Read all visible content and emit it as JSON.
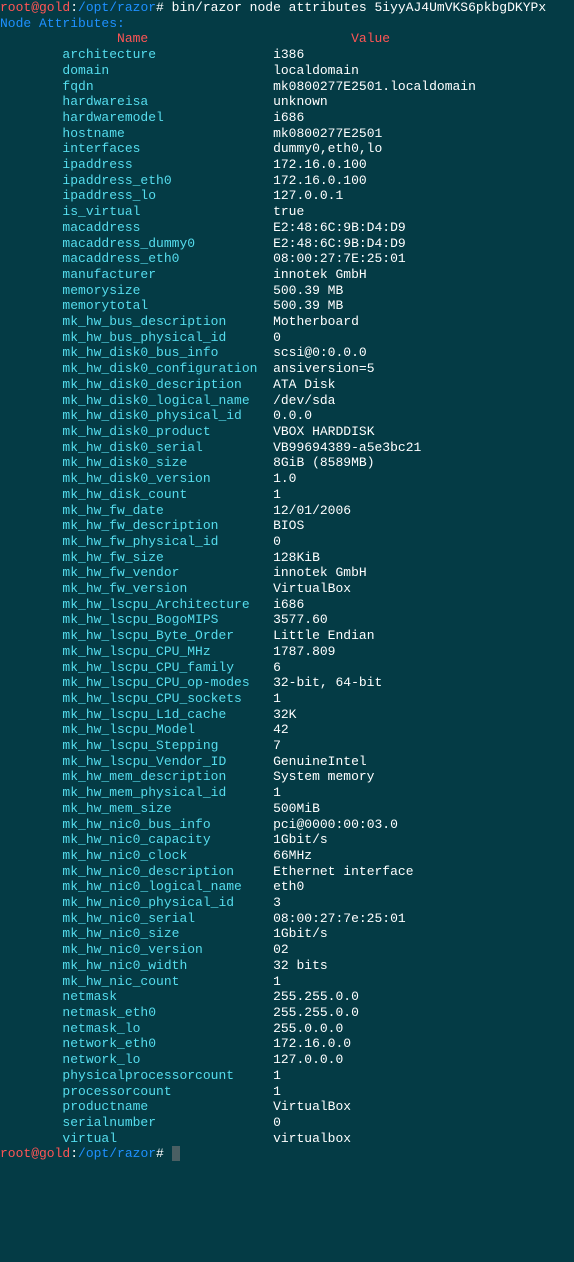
{
  "prompt1": {
    "user_host": "root@gold",
    "sep": ":",
    "path": "/opt/razor",
    "hash": "# ",
    "command": "bin/razor node attributes 5iyyAJ4UmVKS6pkbgDKYPx"
  },
  "heading": "Node Attributes:",
  "header_name": "Name",
  "header_value": "Value",
  "attributes": [
    {
      "name": "architecture",
      "value": "i386"
    },
    {
      "name": "domain",
      "value": "localdomain"
    },
    {
      "name": "fqdn",
      "value": "mk0800277E2501.localdomain"
    },
    {
      "name": "hardwareisa",
      "value": "unknown"
    },
    {
      "name": "hardwaremodel",
      "value": "i686"
    },
    {
      "name": "hostname",
      "value": "mk0800277E2501"
    },
    {
      "name": "interfaces",
      "value": "dummy0,eth0,lo"
    },
    {
      "name": "ipaddress",
      "value": "172.16.0.100"
    },
    {
      "name": "ipaddress_eth0",
      "value": "172.16.0.100"
    },
    {
      "name": "ipaddress_lo",
      "value": "127.0.0.1"
    },
    {
      "name": "is_virtual",
      "value": "true"
    },
    {
      "name": "macaddress",
      "value": "E2:48:6C:9B:D4:D9"
    },
    {
      "name": "macaddress_dummy0",
      "value": "E2:48:6C:9B:D4:D9"
    },
    {
      "name": "macaddress_eth0",
      "value": "08:00:27:7E:25:01"
    },
    {
      "name": "manufacturer",
      "value": "innotek GmbH"
    },
    {
      "name": "memorysize",
      "value": "500.39 MB"
    },
    {
      "name": "memorytotal",
      "value": "500.39 MB"
    },
    {
      "name": "mk_hw_bus_description",
      "value": "Motherboard"
    },
    {
      "name": "mk_hw_bus_physical_id",
      "value": "0"
    },
    {
      "name": "mk_hw_disk0_bus_info",
      "value": "scsi@0:0.0.0"
    },
    {
      "name": "mk_hw_disk0_configuration",
      "value": "ansiversion=5"
    },
    {
      "name": "mk_hw_disk0_description",
      "value": "ATA Disk"
    },
    {
      "name": "mk_hw_disk0_logical_name",
      "value": "/dev/sda"
    },
    {
      "name": "mk_hw_disk0_physical_id",
      "value": "0.0.0"
    },
    {
      "name": "mk_hw_disk0_product",
      "value": "VBOX HARDDISK"
    },
    {
      "name": "mk_hw_disk0_serial",
      "value": "VB99694389-a5e3bc21"
    },
    {
      "name": "mk_hw_disk0_size",
      "value": "8GiB (8589MB)"
    },
    {
      "name": "mk_hw_disk0_version",
      "value": "1.0"
    },
    {
      "name": "mk_hw_disk_count",
      "value": "1"
    },
    {
      "name": "mk_hw_fw_date",
      "value": "12/01/2006"
    },
    {
      "name": "mk_hw_fw_description",
      "value": "BIOS"
    },
    {
      "name": "mk_hw_fw_physical_id",
      "value": "0"
    },
    {
      "name": "mk_hw_fw_size",
      "value": "128KiB"
    },
    {
      "name": "mk_hw_fw_vendor",
      "value": "innotek GmbH"
    },
    {
      "name": "mk_hw_fw_version",
      "value": "VirtualBox"
    },
    {
      "name": "mk_hw_lscpu_Architecture",
      "value": "i686"
    },
    {
      "name": "mk_hw_lscpu_BogoMIPS",
      "value": "3577.60"
    },
    {
      "name": "mk_hw_lscpu_Byte_Order",
      "value": "Little Endian"
    },
    {
      "name": "mk_hw_lscpu_CPU_MHz",
      "value": "1787.809"
    },
    {
      "name": "mk_hw_lscpu_CPU_family",
      "value": "6"
    },
    {
      "name": "mk_hw_lscpu_CPU_op-modes",
      "value": "32-bit, 64-bit"
    },
    {
      "name": "mk_hw_lscpu_CPU_sockets",
      "value": "1"
    },
    {
      "name": "mk_hw_lscpu_L1d_cache",
      "value": "32K"
    },
    {
      "name": "mk_hw_lscpu_Model",
      "value": "42"
    },
    {
      "name": "mk_hw_lscpu_Stepping",
      "value": "7"
    },
    {
      "name": "mk_hw_lscpu_Vendor_ID",
      "value": "GenuineIntel"
    },
    {
      "name": "mk_hw_mem_description",
      "value": "System memory"
    },
    {
      "name": "mk_hw_mem_physical_id",
      "value": "1"
    },
    {
      "name": "mk_hw_mem_size",
      "value": "500MiB"
    },
    {
      "name": "mk_hw_nic0_bus_info",
      "value": "pci@0000:00:03.0"
    },
    {
      "name": "mk_hw_nic0_capacity",
      "value": "1Gbit/s"
    },
    {
      "name": "mk_hw_nic0_clock",
      "value": "66MHz"
    },
    {
      "name": "mk_hw_nic0_description",
      "value": "Ethernet interface"
    },
    {
      "name": "mk_hw_nic0_logical_name",
      "value": "eth0"
    },
    {
      "name": "mk_hw_nic0_physical_id",
      "value": "3"
    },
    {
      "name": "mk_hw_nic0_serial",
      "value": "08:00:27:7e:25:01"
    },
    {
      "name": "mk_hw_nic0_size",
      "value": "1Gbit/s"
    },
    {
      "name": "mk_hw_nic0_version",
      "value": "02"
    },
    {
      "name": "mk_hw_nic0_width",
      "value": "32 bits"
    },
    {
      "name": "mk_hw_nic_count",
      "value": "1"
    },
    {
      "name": "netmask",
      "value": "255.255.0.0"
    },
    {
      "name": "netmask_eth0",
      "value": "255.255.0.0"
    },
    {
      "name": "netmask_lo",
      "value": "255.0.0.0"
    },
    {
      "name": "network_eth0",
      "value": "172.16.0.0"
    },
    {
      "name": "network_lo",
      "value": "127.0.0.0"
    },
    {
      "name": "physicalprocessorcount",
      "value": "1"
    },
    {
      "name": "processorcount",
      "value": "1"
    },
    {
      "name": "productname",
      "value": "VirtualBox"
    },
    {
      "name": "serialnumber",
      "value": "0"
    },
    {
      "name": "virtual",
      "value": "virtualbox"
    }
  ],
  "prompt2": {
    "user_host": "root@gold",
    "sep": ":",
    "path": "/opt/razor",
    "hash": "# "
  }
}
